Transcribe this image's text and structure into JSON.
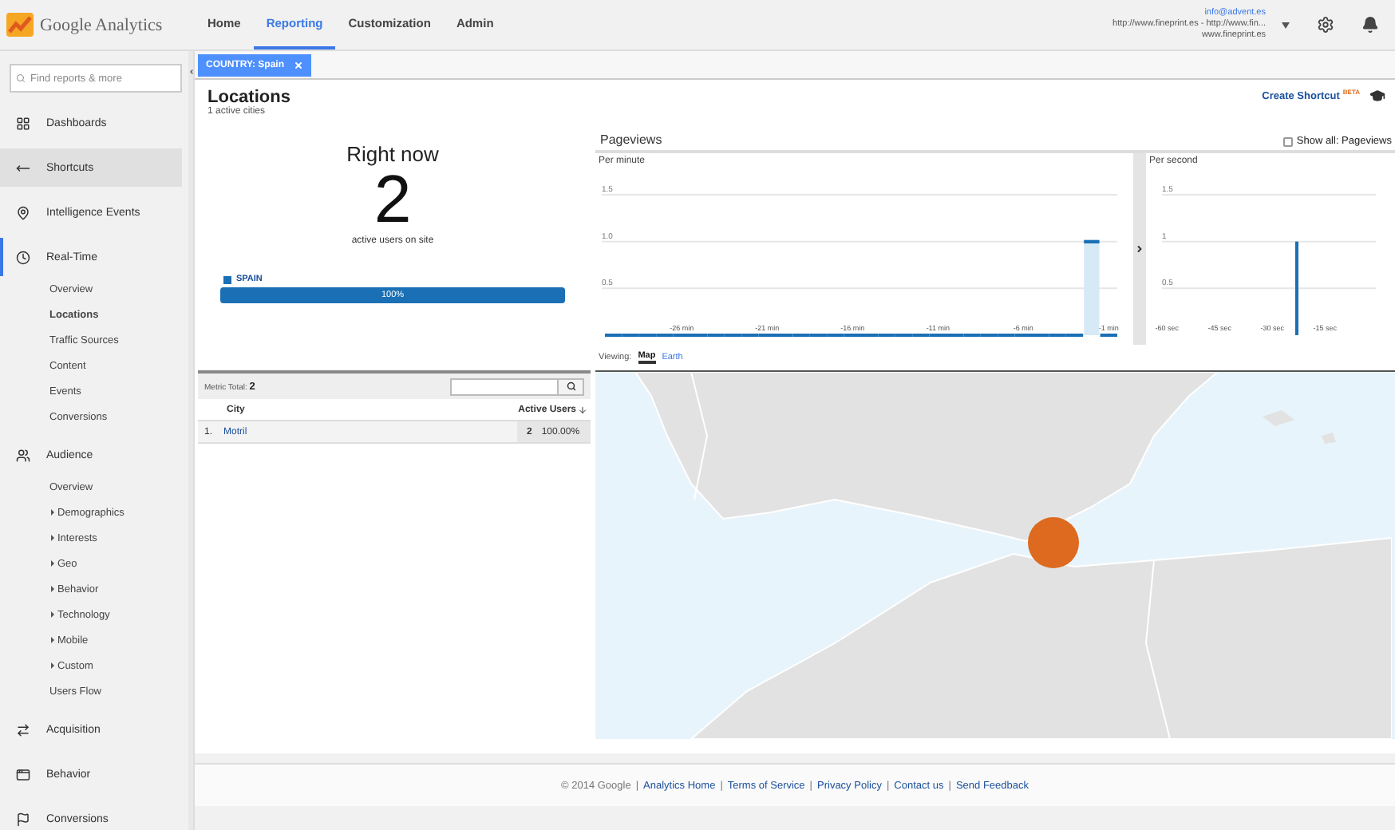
{
  "header": {
    "product": "Google Analytics",
    "nav": [
      {
        "label": "Home",
        "selected": false
      },
      {
        "label": "Reporting",
        "selected": true
      },
      {
        "label": "Customization",
        "selected": false
      },
      {
        "label": "Admin",
        "selected": false
      }
    ],
    "account": {
      "email": "info@advent.es",
      "property": "http://www.fineprint.es - http://www.fin...",
      "view": "www.fineprint.es"
    }
  },
  "sidebar": {
    "search": {
      "placeholder": "Find reports & more"
    },
    "items": [
      {
        "label": "Dashboards",
        "selected": false,
        "highlighted": false
      },
      {
        "label": "Shortcuts",
        "selected": false,
        "highlighted": true
      },
      {
        "label": "Intelligence Events",
        "selected": false,
        "highlighted": false
      },
      {
        "label": "Real-Time",
        "selected": true,
        "highlighted": false,
        "children": [
          {
            "label": "Overview",
            "selected": false,
            "expandable": false
          },
          {
            "label": "Locations",
            "selected": true,
            "expandable": false
          },
          {
            "label": "Traffic Sources",
            "selected": false,
            "expandable": false
          },
          {
            "label": "Content",
            "selected": false,
            "expandable": false
          },
          {
            "label": "Events",
            "selected": false,
            "expandable": false
          },
          {
            "label": "Conversions",
            "selected": false,
            "expandable": false
          }
        ]
      },
      {
        "label": "Audience",
        "selected": false,
        "highlighted": false,
        "children": [
          {
            "label": "Overview",
            "selected": false,
            "expandable": false
          },
          {
            "label": "Demographics",
            "selected": false,
            "expandable": true
          },
          {
            "label": "Interests",
            "selected": false,
            "expandable": true
          },
          {
            "label": "Geo",
            "selected": false,
            "expandable": true
          },
          {
            "label": "Behavior",
            "selected": false,
            "expandable": true
          },
          {
            "label": "Technology",
            "selected": false,
            "expandable": true
          },
          {
            "label": "Mobile",
            "selected": false,
            "expandable": true
          },
          {
            "label": "Custom",
            "selected": false,
            "expandable": true
          },
          {
            "label": "Users Flow",
            "selected": false,
            "expandable": false
          }
        ]
      },
      {
        "label": "Acquisition",
        "selected": false,
        "highlighted": false
      },
      {
        "label": "Behavior",
        "selected": false,
        "highlighted": false
      },
      {
        "label": "Conversions",
        "selected": false,
        "highlighted": false
      }
    ]
  },
  "filter": {
    "chip": "COUNTRY: Spain"
  },
  "report": {
    "title": "Locations",
    "subtitle": "1 active cities",
    "create_shortcut": "Create Shortcut",
    "beta": "BETA"
  },
  "right_now": {
    "heading": "Right now",
    "count": "2",
    "caption": "active users on site",
    "legend": "SPAIN",
    "bar_label": "100%",
    "level": 1
  },
  "table": {
    "metric_total_label": "Metric Total:",
    "metric_total": "2",
    "columns": [
      {
        "label": "City",
        "sorted": false
      },
      {
        "label": "Active Users",
        "sorted": true
      }
    ],
    "rows": [
      {
        "index": "1.",
        "city": "Motril",
        "users": "2",
        "share": "100.00%"
      }
    ]
  },
  "pageviews": {
    "title": "Pageviews",
    "show_all": {
      "label": "Show all: Pageviews",
      "checked": false
    },
    "per_minute": {
      "title": "Per minute",
      "chart_data": {
        "type": "bar",
        "x": [
          -30,
          -29,
          -28,
          -27,
          -26,
          -25,
          -24,
          -23,
          -22,
          -21,
          -20,
          -19,
          -18,
          -17,
          -16,
          -15,
          -14,
          -13,
          -12,
          -11,
          -10,
          -9,
          -8,
          -7,
          -6,
          -5,
          -4,
          -3,
          -2,
          -1
        ],
        "values": [
          0,
          0,
          0,
          0,
          0,
          0,
          0,
          0,
          0,
          0,
          0,
          0,
          0,
          0,
          0,
          0,
          0,
          0,
          0,
          0,
          0,
          0,
          0,
          0,
          0,
          0,
          0,
          0,
          1,
          0
        ],
        "xlim": [
          -30.5,
          -0.5
        ],
        "ylim": [
          0,
          1.5
        ],
        "yticks": [
          {
            "value": 0.5,
            "label": "0.5"
          },
          {
            "value": 1,
            "label": "1.0"
          },
          {
            "value": 1.5,
            "label": "1.5"
          }
        ],
        "xticks": [
          {
            "value": -26,
            "label": "-26 min"
          },
          {
            "value": -21,
            "label": "-21 min"
          },
          {
            "value": -16,
            "label": "-16 min"
          },
          {
            "value": -11,
            "label": "-11 min"
          },
          {
            "value": -6,
            "label": "-6 min"
          },
          {
            "value": -1,
            "label": "-1 min"
          }
        ]
      }
    },
    "per_second": {
      "title": "Per second",
      "chart_data": {
        "type": "bar",
        "x": [
          -60,
          -59,
          -58,
          -57,
          -56,
          -55,
          -54,
          -53,
          -52,
          -51,
          -50,
          -49,
          -48,
          -47,
          -46,
          -45,
          -44,
          -43,
          -42,
          -41,
          -40,
          -39,
          -38,
          -37,
          -36,
          -35,
          -34,
          -33,
          -32,
          -31,
          -30,
          -29,
          -28,
          -27,
          -26,
          -25,
          -24,
          -23,
          -22,
          -21,
          -20,
          -19,
          -18,
          -17,
          -16,
          -15,
          -14,
          -13,
          -12,
          -11,
          -10,
          -9,
          -8,
          -7,
          -6,
          -5,
          -4,
          -3,
          -2,
          -1
        ],
        "values": [
          0,
          0,
          0,
          0,
          0,
          0,
          0,
          0,
          0,
          0,
          0,
          0,
          0,
          0,
          0,
          0,
          0,
          0,
          0,
          0,
          0,
          0,
          0,
          0,
          0,
          0,
          0,
          0,
          0,
          0,
          0,
          0,
          0,
          0,
          0,
          0,
          0,
          1,
          0,
          0,
          0,
          0,
          0,
          0,
          0,
          0,
          0,
          0,
          0,
          0,
          0,
          0,
          0,
          0,
          0,
          0,
          0,
          0,
          0,
          0
        ],
        "xlim": [
          -60.5,
          -0.5
        ],
        "ylim": [
          0,
          1.5
        ],
        "yticks": [
          0.5,
          1,
          1.5
        ],
        "xticks": [
          {
            "value": -60,
            "label": "-60 sec"
          },
          {
            "value": -45,
            "label": "-45 sec"
          },
          {
            "value": -30,
            "label": "-30 sec"
          },
          {
            "value": -15,
            "label": "-15 sec"
          }
        ]
      }
    }
  },
  "viewing": {
    "label": "Viewing:",
    "tabs": [
      {
        "label": "Map",
        "selected": true
      },
      {
        "label": "Earth",
        "selected": false
      }
    ]
  },
  "footer": {
    "copyright": "© 2014 Google",
    "separator": "|",
    "links": [
      "Analytics Home",
      "Terms of Service",
      "Privacy Policy",
      "Contact us",
      "Send Feedback"
    ]
  }
}
